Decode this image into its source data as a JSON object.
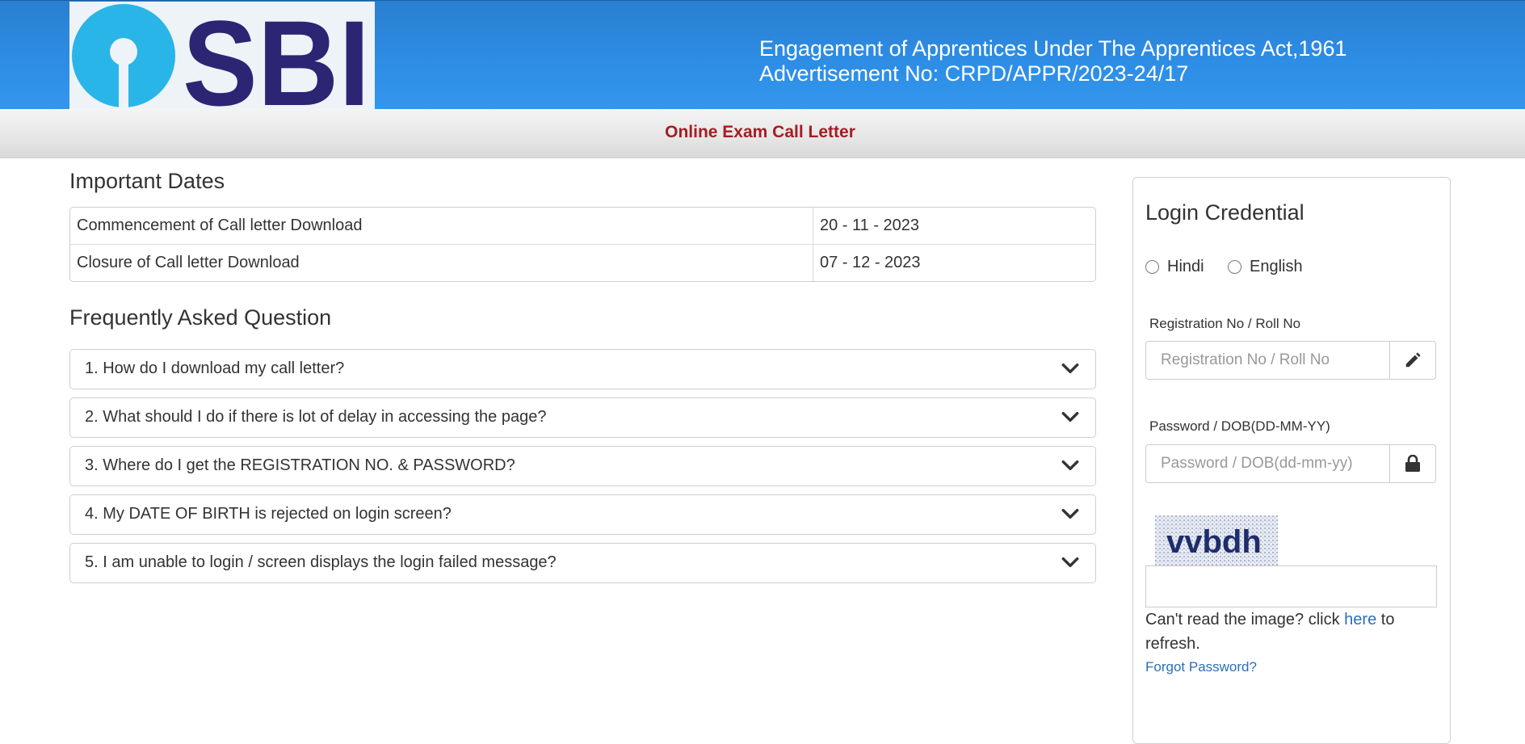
{
  "header": {
    "logo_text": "SBI",
    "title_line1": "Engagement of Apprentices Under The Apprentices Act,1961",
    "title_line2": "Advertisement No: CRPD/APPR/2023-24/17"
  },
  "subheader": {
    "title": "Online Exam Call Letter"
  },
  "important_dates": {
    "heading": "Important Dates",
    "rows": [
      {
        "label": "Commencement of Call letter Download",
        "date": "20 - 11 - 2023"
      },
      {
        "label": "Closure of Call letter Download",
        "date": "07 - 12 - 2023"
      }
    ]
  },
  "faq": {
    "heading": "Frequently Asked Question",
    "items": [
      "1. How do I download my call letter?",
      "2. What should I do if there is lot of delay in accessing the page?",
      "3. Where do I get the REGISTRATION NO. & PASSWORD?",
      "4. My DATE OF BIRTH is rejected on login screen?",
      "5. I am unable to login / screen displays the login failed message?"
    ]
  },
  "login": {
    "title": "Login Credential",
    "language_options": [
      "Hindi",
      "English"
    ],
    "registration_label": "Registration No / Roll No",
    "registration_placeholder": "Registration No / Roll No",
    "password_label": "Password / DOB(DD-MM-YY)",
    "password_placeholder": "Password / DOB(dd-mm-yy)",
    "captcha_text": "vvbdh",
    "captcha_input_value": "",
    "refresh_prefix": "Can't read the image? click ",
    "refresh_link": "here",
    "refresh_suffix": " to refresh.",
    "forgot_password": "Forgot Password?"
  },
  "colors": {
    "header_blue": "#2e8ee6",
    "logo_light_blue": "#29b5e8",
    "logo_dark_blue": "#2b2573",
    "subheader_title": "#a61c24",
    "link": "#2a6fba"
  },
  "icons": {
    "faq_toggle": "chevron-down-icon",
    "registration_addon": "pencil-icon",
    "password_addon": "lock-icon"
  }
}
